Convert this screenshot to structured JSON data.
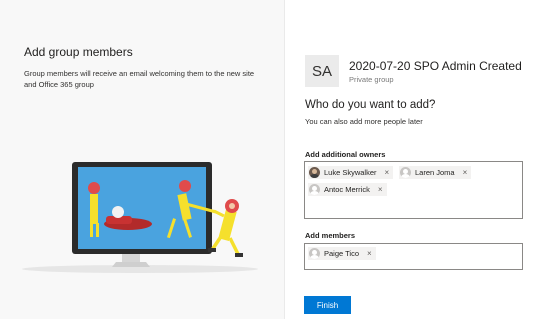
{
  "left": {
    "title": "Add group members",
    "description": "Group members will receive an email welcoming them to the new site and Office 365 group"
  },
  "site": {
    "initials": "SA",
    "name": "2020-07-20 SPO Admin Created",
    "privacy": "Private group"
  },
  "prompt": {
    "title": "Who do you want to add?",
    "subtitle": "You can also add more people later"
  },
  "owners": {
    "label": "Add additional owners",
    "people": [
      "Luke Skywalker",
      "Laren Joma",
      "Antoc Merrick"
    ]
  },
  "members": {
    "label": "Add members",
    "people": [
      "Paige Tico"
    ]
  },
  "remove_glyph": "×",
  "finish_label": "Finish",
  "colors": {
    "accent": "#0078d4",
    "illustration_yellow": "#f5e02c",
    "illustration_red": "#d13438"
  },
  "icons": [
    "person-avatar-icon",
    "remove-icon"
  ]
}
